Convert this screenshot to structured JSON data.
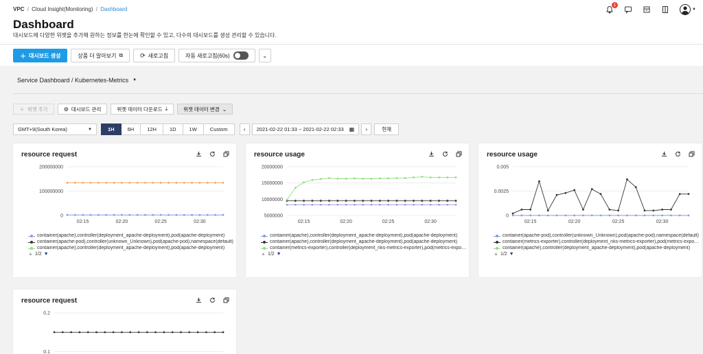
{
  "breadcrumb": {
    "root": "VPC",
    "parent": "Cloud Insight(Monitoring)",
    "current": "Dashboard",
    "separator": "/"
  },
  "header": {
    "title": "Dashboard",
    "description": "대시보드에 다양한 위젯을 추가해 원하는 정보를 한눈에 확인할 수 있고, 다수의 대시보드를 생성 관리할 수 있습니다.",
    "notification_count": "1"
  },
  "toolbar": {
    "create_label": "대시보드 생성",
    "learn_more_label": "상품 더 알아보기",
    "refresh_label": "새로고침",
    "auto_refresh_label": "자동 새로고침(60s)"
  },
  "dashboard_select": {
    "value": "Service Dashboard / Kubernetes-Metrics"
  },
  "widget_toolbar": {
    "add_widget_label": "위젯 추가",
    "manage_label": "대시보드 관리",
    "download_label": "위젯 데이터 다운로드",
    "change_label": "위젯 데이터 변경"
  },
  "time": {
    "timezone": "GMT+9(South Korea)",
    "ranges": [
      "1H",
      "6H",
      "12H",
      "1D",
      "1W",
      "Custom"
    ],
    "active_range": "1H",
    "date_range": "2021-02-22 01:33 ~ 2021-02-22 02:33",
    "now_label": "현재"
  },
  "colors": {
    "primary": "#1e9be6",
    "active_range": "#2c3e66",
    "orange": "#f5a35c",
    "blue": "#8a9be6",
    "black": "#333333",
    "green": "#8fe07f",
    "purple": "#9a9ae0"
  },
  "chart_data": [
    {
      "type": "line",
      "title": "resource request",
      "x": [
        "02:13",
        "02:14",
        "02:15",
        "02:16",
        "02:17",
        "02:18",
        "02:19",
        "02:20",
        "02:21",
        "02:22",
        "02:23",
        "02:24",
        "02:25",
        "02:26",
        "02:27",
        "02:28",
        "02:29",
        "02:30",
        "02:31",
        "02:32",
        "02:33"
      ],
      "xticks": [
        "02:15",
        "02:20",
        "02:25",
        "02:30"
      ],
      "yticks": [
        "0",
        "100000000",
        "200000000"
      ],
      "ylim": [
        0,
        200000000
      ],
      "series": [
        {
          "name": "container(apache),controller(deployment_apache-deployment),pod(apache-deployment)",
          "color": "#8a9be6",
          "values": [
            2000000,
            2000000,
            2000000,
            2000000,
            2000000,
            2000000,
            2000000,
            2000000,
            2000000,
            2000000,
            2000000,
            2000000,
            2000000,
            2000000,
            2000000,
            2000000,
            2000000,
            2000000,
            2000000,
            2000000,
            2000000
          ]
        },
        {
          "name": "container(apache-pod),controller(unknown_Unknown),pod(apache-pod),namespace(default)",
          "color": "#333333",
          "values": []
        },
        {
          "name": "container(apache),controller(deployment_apache-deployment),pod(apache-deployment)",
          "color": "#f5a35c",
          "values": [
            134000000,
            134000000,
            134000000,
            134000000,
            134000000,
            134000000,
            134000000,
            134000000,
            134000000,
            134000000,
            134000000,
            134000000,
            134000000,
            134000000,
            134000000,
            134000000,
            134000000,
            134000000,
            134000000,
            134000000,
            134000000
          ]
        }
      ],
      "legend_order": [
        0,
        1,
        2
      ],
      "page": "1/2"
    },
    {
      "type": "line",
      "title": "resource usage",
      "x": [
        "02:13",
        "02:14",
        "02:15",
        "02:16",
        "02:17",
        "02:18",
        "02:19",
        "02:20",
        "02:21",
        "02:22",
        "02:23",
        "02:24",
        "02:25",
        "02:26",
        "02:27",
        "02:28",
        "02:29",
        "02:30",
        "02:31",
        "02:32",
        "02:33"
      ],
      "xticks": [
        "02:15",
        "02:20",
        "02:25",
        "02:30"
      ],
      "yticks": [
        "5000000",
        "10000000",
        "15000000",
        "20000000"
      ],
      "ylim": [
        5000000,
        20000000
      ],
      "series": [
        {
          "name": "container(apache),controller(deployment_apache-deployment),pod(apache-deployment)",
          "color": "#9a9ae0",
          "values": [
            8300000,
            8300000,
            8300000,
            8300000,
            8300000,
            8300000,
            8300000,
            8300000,
            8300000,
            8300000,
            8300000,
            8300000,
            8300000,
            8300000,
            8300000,
            8300000,
            8300000,
            8300000,
            8300000,
            8300000,
            8300000
          ]
        },
        {
          "name": "container(apache),controller(deployment_apache-deployment),pod(apache-deployment)",
          "color": "#333333",
          "values": [
            9500000,
            9500000,
            9500000,
            9500000,
            9500000,
            9500000,
            9500000,
            9500000,
            9500000,
            9500000,
            9500000,
            9500000,
            9500000,
            9500000,
            9500000,
            9500000,
            9500000,
            9500000,
            9500000,
            9500000,
            9500000
          ]
        },
        {
          "name": "container(metrics-exporter),controller(deployment_nks-metrics-exporter),pod(metrics-exporter)",
          "color": "#8fe07f",
          "values": [
            9800000,
            13500000,
            15200000,
            15900000,
            16200000,
            16500000,
            16300000,
            16300000,
            16400000,
            16300000,
            16300000,
            16400000,
            16400000,
            16500000,
            16500000,
            16700000,
            16900000,
            16700000,
            16700000,
            16700000,
            16700000
          ]
        }
      ],
      "legend_order": [
        0,
        1,
        2
      ],
      "page": "1/2"
    },
    {
      "type": "line",
      "title": "resource usage",
      "x": [
        "02:13",
        "02:14",
        "02:15",
        "02:16",
        "02:17",
        "02:18",
        "02:19",
        "02:20",
        "02:21",
        "02:22",
        "02:23",
        "02:24",
        "02:25",
        "02:26",
        "02:27",
        "02:28",
        "02:29",
        "02:30",
        "02:31",
        "02:32",
        "02:33"
      ],
      "xticks": [
        "02:15",
        "02:20",
        "02:25",
        "02:30"
      ],
      "yticks": [
        "0",
        "0.0025",
        "0.005"
      ],
      "ylim": [
        0,
        0.005
      ],
      "series": [
        {
          "name": "container(apache-pod),controller(unknown_Unknown),pod(apache-pod),namespace(default)",
          "color": "#8a9be6",
          "values": [
            0,
            0,
            0,
            0,
            0,
            0,
            0,
            0,
            0,
            0,
            0,
            0,
            0,
            0,
            0,
            0,
            0,
            0,
            0,
            0,
            0
          ]
        },
        {
          "name": "container(metrics-exporter),controller(deployment_nks-metrics-exporter),pod(metrics-exporter)",
          "color": "#333333",
          "values": [
            0.0002,
            0.0006,
            0.0006,
            0.0035,
            0.0005,
            0.0021,
            0.0023,
            0.0026,
            0.0006,
            0.0027,
            0.0022,
            0.0006,
            0.0005,
            0.0037,
            0.0029,
            0.0005,
            0.0005,
            0.0006,
            0.0006,
            0.0022,
            0.0022
          ]
        },
        {
          "name": "container(apache),controller(deployment_apache-deployment),pod(apache-deployment)",
          "color": "#8fe07f",
          "values": []
        }
      ],
      "legend_order": [
        0,
        1,
        2
      ],
      "page": "1/2"
    },
    {
      "type": "line",
      "title": "resource request",
      "x": [
        "02:13",
        "02:14",
        "02:15",
        "02:16",
        "02:17",
        "02:18",
        "02:19",
        "02:20",
        "02:21",
        "02:22",
        "02:23",
        "02:24",
        "02:25",
        "02:26",
        "02:27",
        "02:28",
        "02:29",
        "02:30",
        "02:31",
        "02:32",
        "02:33"
      ],
      "xticks": [],
      "yticks": [
        "0.1",
        "0.2"
      ],
      "ylim": [
        0,
        0.2
      ],
      "series": [
        {
          "name": "",
          "color": "#333333",
          "values": [
            0.15,
            0.15,
            0.15,
            0.15,
            0.15,
            0.15,
            0.15,
            0.15,
            0.15,
            0.15,
            0.15,
            0.15,
            0.15,
            0.15,
            0.15,
            0.15,
            0.15,
            0.15,
            0.15,
            0.15,
            0.15
          ]
        }
      ],
      "legend_order": [],
      "page": ""
    }
  ]
}
